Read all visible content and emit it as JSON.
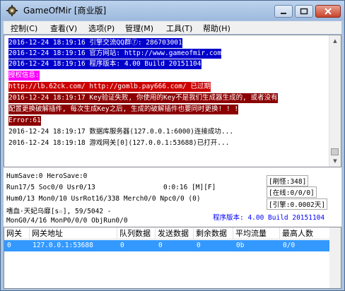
{
  "window": {
    "title": "GameOfMir [商业版]",
    "icon": "gear-icon"
  },
  "menu": [
    "控制(C)",
    "查看(V)",
    "选项(P)",
    "管理(M)",
    "工具(T)",
    "帮助(H)"
  ],
  "log": [
    {
      "text": "2016-12-24 18:19:16 引擎交流QQ群⑦: 286703001",
      "fg": "#ffffff",
      "bg": "#0000cc"
    },
    {
      "text": "2016-12-24 18:19:16 官方网站: http://www.gameofmir.com",
      "fg": "#ffffff",
      "bg": "#0000cc"
    },
    {
      "text": "2016-12-24 18:19:16 程序版本: 4.00 Build 20151104",
      "fg": "#ffffff",
      "bg": "#0000cc"
    },
    {
      "text": "授权信息:",
      "fg": "#ffffff",
      "bg": "#ff00ff"
    },
    {
      "text": "http://lb.62ck.com/ http://gomlb.pay666.com/ 已过期",
      "fg": "#ffffff",
      "bg": "#cc0000"
    },
    {
      "text": "2016-12-24 18:19:17 Key验证失败, 你使用的Key不是我们生成器生成的, 或者没有",
      "fg": "#ffffff",
      "bg": "#8b0000"
    },
    {
      "text": "配置更换破解插件, 每次生成Key之后, 生成的破解插件也要同时更换! ! !",
      "fg": "#ffffff",
      "bg": "#8b0000"
    },
    {
      "text": "Error:61",
      "fg": "#ffffff",
      "bg": "#8b0000"
    },
    {
      "text": "2016-12-24 18:19:17 数据库服务器(127.0.0.1:6000)连接成功...",
      "fg": "#000000",
      "bg": ""
    },
    {
      "text": "2016-12-24 18:19:18 游戏网关[0](127.0.0.1:53688)已打开...",
      "fg": "#000000",
      "bg": ""
    }
  ],
  "status": {
    "line1": "HumSave:0 HeroSave:0",
    "line2": "Run17/5 Soc0/0 Usr0/13",
    "time": "0:0:16 [M][F]",
    "line3": "Hum0/13 Mon0/10 UsrRot16/338 Merch0/0 Npc0/0 (0)",
    "line4": "嗜血·天妃乌靡[s☆], 59/5042 -",
    "line5": "MonG0/4/16 MonP0/0/0 ObjRun0/0",
    "refresh": "[刷怪:348]",
    "online": "[在线:0/0/0]",
    "lead": "[引擎:0.0002天]",
    "version": "程序版本: 4.00 Build 20151104",
    "version_color": "#0000ff"
  },
  "table": {
    "columns": [
      "网关",
      "网关地址",
      "队列数据",
      "发送数据",
      "剩余数据",
      "平均流量",
      "最高人数"
    ],
    "rows": [
      [
        "0",
        "127.0.0.1:53688",
        "0",
        "0",
        "0",
        "0b",
        "0/0"
      ]
    ]
  }
}
